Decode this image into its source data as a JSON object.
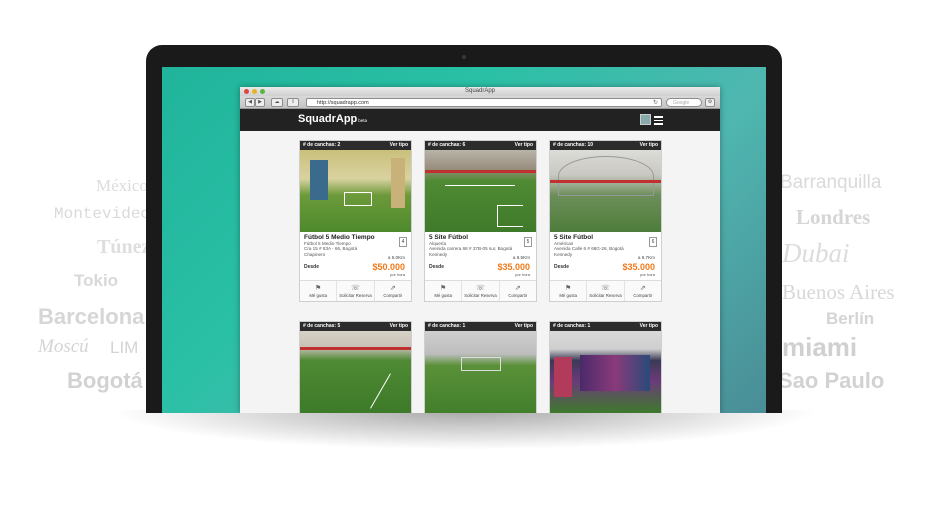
{
  "background_cities": [
    {
      "name": "México"
    },
    {
      "name": "Montevideo"
    },
    {
      "name": "Túnez"
    },
    {
      "name": "Tokio"
    },
    {
      "name": "Barcelona"
    },
    {
      "name": "Moscú"
    },
    {
      "name": "LIM"
    },
    {
      "name": "Bogotá"
    },
    {
      "name": "Barranquilla"
    },
    {
      "name": "Londres"
    },
    {
      "name": "Dubai"
    },
    {
      "name": "Buenos Aires"
    },
    {
      "name": "Berlín"
    },
    {
      "name": "miami"
    },
    {
      "name": "Sao Paulo"
    }
  ],
  "browser": {
    "window_title": "SquadrApp",
    "url": "http://squadrapp.com",
    "search_placeholder": "Google",
    "nav_back": "◀",
    "nav_forward": "▶"
  },
  "app": {
    "logo": "SquadrApp",
    "logo_badge": "beta"
  },
  "cards": [
    {
      "count_label": "# de canchas: 2",
      "type_link": "Ver tipo",
      "title": "Fútbol 5 Medio Tiempo",
      "line1": "Fútbol 5 Medio Tiempo",
      "line2": "Cra 15 # 83A - 66, Bogotá",
      "line3": "Chapinero",
      "distance": "a 6.0Km",
      "number": "4",
      "desde": "Desde",
      "price": "$50.000",
      "per": "por hora",
      "act1": "Mé gusta",
      "act2": "Solicitar Reserva",
      "act3": "Compartir"
    },
    {
      "count_label": "# de canchas: 6",
      "type_link": "Ver tipo",
      "title": "5 Site Fútbol",
      "line1": "Alquería",
      "line2": "Avenida carrera 68 # 37B-05 sur, Bogotá",
      "line3": "Kennedy",
      "distance": "a 6.5Km",
      "number": "5",
      "desde": "Desde",
      "price": "$35.000",
      "per": "por hora",
      "act1": "Mé gusta",
      "act2": "Solicitar Reserva",
      "act3": "Compartir"
    },
    {
      "count_label": "# de canchas: 10",
      "type_link": "Ver tipo",
      "title": "5 Site Fútbol",
      "line1": "Américas",
      "line2": "Avenida Calle 6 # 68G-26, Bogotá",
      "line3": "Kennedy",
      "distance": "a 6.7Km",
      "number": "6",
      "desde": "Desde",
      "price": "$35.000",
      "per": "por hora",
      "act1": "Mé gusta",
      "act2": "Solicitar Reserva",
      "act3": "Compartir"
    },
    {
      "count_label": "# de canchas: 5",
      "type_link": "Ver tipo"
    },
    {
      "count_label": "# de canchas: 1",
      "type_link": "Ver tipo"
    },
    {
      "count_label": "# de canchas: 1",
      "type_link": "Ver tipo"
    }
  ]
}
